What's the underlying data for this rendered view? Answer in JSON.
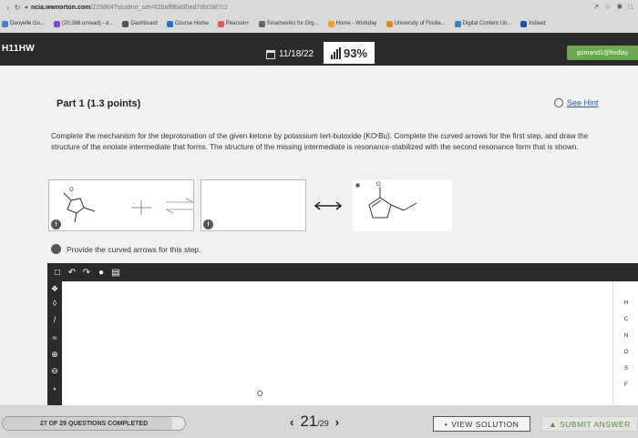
{
  "browser": {
    "url_host": "ncia.wwnorton.com",
    "url_path": "/225864?student_set=62baff8fa6f0ed7db0387c2",
    "bookmarks": [
      {
        "label": "Danyelle Go...",
        "color": "#4a7bd0"
      },
      {
        "label": "(20,368 unread) - d...",
        "color": "#7b4ad0"
      },
      {
        "label": "Dashboard",
        "color": "#555555"
      },
      {
        "label": "Course Home",
        "color": "#2a6fc4"
      },
      {
        "label": "Pearson+",
        "color": "#e05a5a"
      },
      {
        "label": "Smartworks for Org...",
        "color": "#666666"
      },
      {
        "label": "Home - Workday",
        "color": "#f0a020"
      },
      {
        "label": "University of Findla...",
        "color": "#e08a20"
      },
      {
        "label": "Digital Content Un...",
        "color": "#3a80c0"
      },
      {
        "label": "Indeed",
        "color": "#2050a0"
      }
    ]
  },
  "header": {
    "title": "H11HW",
    "date": "11/18/22",
    "score_label": "SCORE",
    "score": "93%",
    "user": "gomand1@findlay"
  },
  "question": {
    "part": "Part 1",
    "points": "(1.3 points)",
    "hint": "See Hint",
    "text": "Complete the mechanism for the deprotonation of the given ketone by potassium tert-butoxide (KOᵗBu). Complete the curved arrows for the first step, and draw the structure of the enolate intermediate that forms. The structure of the missing intermediate is resonance-stabilized with the second resonance form that is shown.",
    "arrows_prompt": "Provide the curved arrows for this step."
  },
  "tool": {
    "elements": [
      "H",
      "C",
      "N",
      "O",
      "S",
      "F"
    ]
  },
  "footer": {
    "progress_text": "27 OF 29 QUESTIONS COMPLETED",
    "progress_fraction": 0.931,
    "current": "21",
    "total": "/29",
    "view_solution": "VIEW SOLUTION",
    "submit": "SUBMIT ANSWER"
  }
}
